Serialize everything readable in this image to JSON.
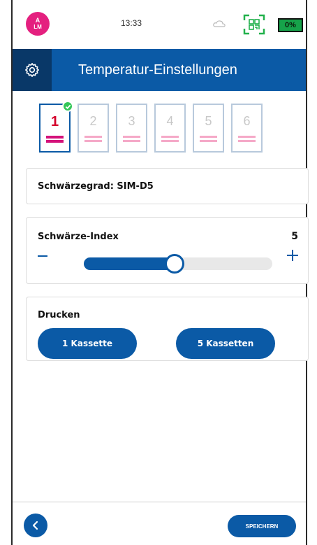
{
  "status_bar": {
    "avatar_top": "A",
    "avatar_bottom": "LM",
    "time": "13:33",
    "battery": "0%",
    "icons": [
      "cloud-icon",
      "qr-scan-icon"
    ]
  },
  "header": {
    "title": "Temperatur-Einstellungen",
    "icon": "gear-icon"
  },
  "cassettes": [
    {
      "label": "1",
      "selected": true
    },
    {
      "label": "2",
      "selected": false
    },
    {
      "label": "3",
      "selected": false
    },
    {
      "label": "4",
      "selected": false
    },
    {
      "label": "5",
      "selected": false
    },
    {
      "label": "6",
      "selected": false
    }
  ],
  "darkness_grade": {
    "label": "Schwärzegrad: SIM-D5"
  },
  "darkness_index": {
    "label": "Schwärze-Index",
    "value": "5",
    "slider_fraction": 0.45
  },
  "print": {
    "label": "Drucken",
    "button_one": "1 Kassette",
    "button_five": "5 Kassetten"
  },
  "footer": {
    "save_label": "SPEICHERN"
  },
  "colors": {
    "primary": "#0b5aa6",
    "header_dark": "#093868",
    "avatar": "#e4207f",
    "battery": "#16a34a",
    "active_number": "#d4002a"
  }
}
